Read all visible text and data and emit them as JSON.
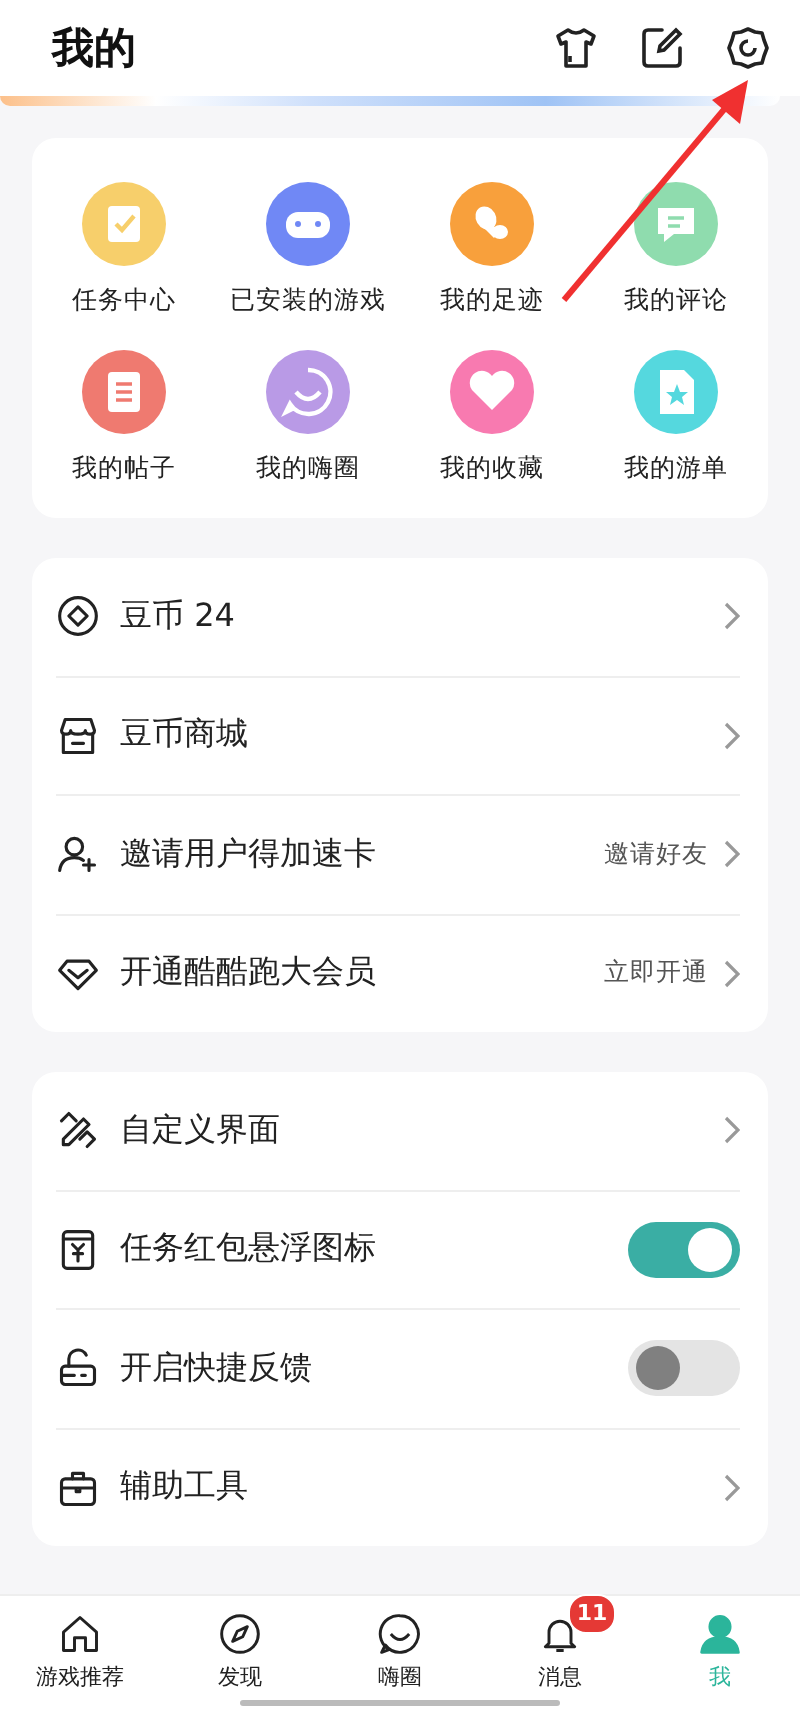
{
  "header": {
    "title": "我的"
  },
  "shortcuts": [
    {
      "label": "任务中心",
      "color": "#f7cf6b"
    },
    {
      "label": "已安装的游戏",
      "color": "#7088f5"
    },
    {
      "label": "我的足迹",
      "color": "#f8a03c"
    },
    {
      "label": "我的评论",
      "color": "#8fdcae"
    },
    {
      "label": "我的帖子",
      "color": "#ef7a70"
    },
    {
      "label": "我的嗨圈",
      "color": "#b99ae6"
    },
    {
      "label": "我的收藏",
      "color": "#f87ab0"
    },
    {
      "label": "我的游单",
      "color": "#55d8de"
    }
  ],
  "sections": [
    {
      "rows": [
        {
          "kind": "link",
          "label": "豆币 24"
        },
        {
          "kind": "link",
          "label": "豆币商城"
        },
        {
          "kind": "link",
          "label": "邀请用户得加速卡",
          "hint": "邀请好友"
        },
        {
          "kind": "link",
          "label": "开通酷酷跑大会员",
          "hint": "立即开通"
        }
      ]
    },
    {
      "rows": [
        {
          "kind": "link",
          "label": "自定义界面"
        },
        {
          "kind": "toggle",
          "label": "任务红包悬浮图标",
          "on": true
        },
        {
          "kind": "toggle",
          "label": "开启快捷反馈",
          "on": false
        },
        {
          "kind": "link",
          "label": "辅助工具"
        }
      ]
    }
  ],
  "tab_bar": [
    {
      "label": "游戏推荐",
      "selected": false
    },
    {
      "label": "发现",
      "selected": false
    },
    {
      "label": "嗨圈",
      "selected": false
    },
    {
      "label": "消息",
      "selected": false,
      "badge": "11"
    },
    {
      "label": "我",
      "selected": true
    }
  ]
}
